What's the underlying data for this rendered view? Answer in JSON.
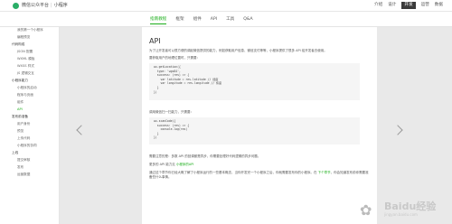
{
  "header": {
    "brand": "微信公众平台",
    "separator": "|",
    "product": "小程序",
    "links": [
      "介绍",
      "设计",
      "开发",
      "运营",
      "数据"
    ],
    "active_link": "开发"
  },
  "nav": {
    "tabs": [
      "指南教程",
      "框架",
      "组件",
      "API",
      "工具",
      "Q&A"
    ],
    "active_tab": "指南教程"
  },
  "sidebar": {
    "items": [
      {
        "label": "我的第一个小程序",
        "type": "item"
      },
      {
        "label": "编程预览",
        "type": "item"
      },
      {
        "label": "代码构成",
        "type": "group"
      },
      {
        "label": "JSON 配置",
        "type": "item"
      },
      {
        "label": "WXML 模板",
        "type": "item"
      },
      {
        "label": "WXSS 样式",
        "type": "item"
      },
      {
        "label": "JS 逻辑交互",
        "type": "item"
      },
      {
        "label": "小程序能力",
        "type": "group"
      },
      {
        "label": "小程序的启动",
        "type": "item"
      },
      {
        "label": "程序与页面",
        "type": "item"
      },
      {
        "label": "组件",
        "type": "item"
      },
      {
        "label": "API",
        "type": "active"
      },
      {
        "label": "发布前准备",
        "type": "group"
      },
      {
        "label": "用户身份",
        "type": "item"
      },
      {
        "label": "预览",
        "type": "item"
      },
      {
        "label": "上传代码",
        "type": "item"
      },
      {
        "label": "小程序的协同",
        "type": "item"
      },
      {
        "label": "上线",
        "type": "group"
      },
      {
        "label": "提交审核",
        "type": "item"
      },
      {
        "label": "发布",
        "type": "item"
      },
      {
        "label": "运营数据",
        "type": "item"
      }
    ]
  },
  "content": {
    "title": "API",
    "intro": "为了让开发者可以很方便的调起微信提供的能力，例如获取用户信息、微信支付等等，小程序提供了很多 API 给开发者去使用。",
    "p_location": "要获取用户的地理位置时，只需要：",
    "code1": [
      "wx.getLocation({",
      "  type: 'wgs84',",
      "  success: (res) => {",
      "    var latitude = res.latitude // 经度",
      "    var longitude = res.longitude // 纬度",
      "  }",
      "})"
    ],
    "p_scan": "调用微信扫一扫能力，只需要：",
    "code2": [
      "wx.scanCode({",
      "  success: (res) => {",
      "    console.log(res)",
      "  }",
      "})"
    ],
    "p_note": "需要注意的是：多数 API 的回调都是异步，你需要处理好代码逻辑的异步问题。",
    "p_more_prefix": "更多的 API 能力见 ",
    "p_more_link": "小程序的API",
    "p_end": "通过这个章节你已经大概了解了小程序运行的一些基本概念，当你开发完一个小程序之后，你就需要发布你的小程序。在 ",
    "p_end_link": "下个章节",
    "p_end_tail": "，你会知道发布前你需要准备些什么事情。"
  },
  "watermark": {
    "text": "Baidu经验",
    "sub": "jingyan.baidu.com"
  }
}
